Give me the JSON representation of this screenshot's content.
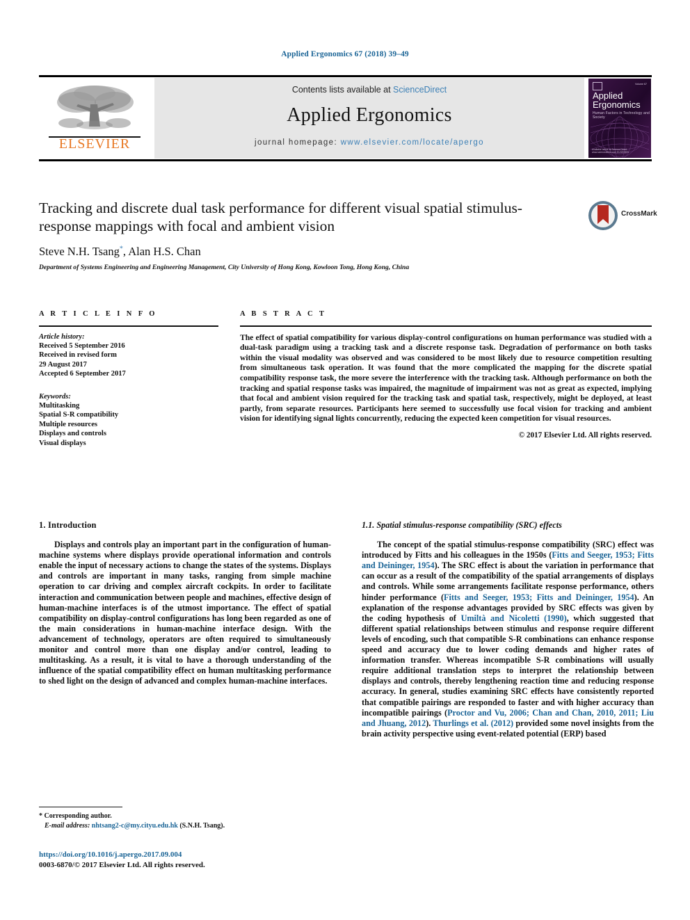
{
  "running_head": "Applied Ergonomics 67 (2018) 39–49",
  "masthead": {
    "contents_prefix": "Contents lists available at ",
    "contents_link": "ScienceDirect",
    "journal_name": "Applied Ergonomics",
    "homepage_prefix": "journal homepage: ",
    "homepage_url": "www.elsevier.com/locate/apergo",
    "publisher": "ELSEVIER",
    "cover": {
      "title": "Applied Ergonomics",
      "subtitle": "Human Factors in Technology and Society",
      "issue": "Volume 67",
      "footer": "Available online at\nScience Direct www.sciencedirect.com ELSEVIER"
    }
  },
  "article": {
    "title": "Tracking and discrete dual task performance for different visual spatial stimulus-response mappings with focal and ambient vision",
    "authors": "Steve N.H. Tsang",
    "author_marker": "*",
    "authors_rest": ", Alan H.S. Chan",
    "affiliation": "Department of Systems Engineering and Engineering Management, City University of Hong Kong, Kowloon Tong, Hong Kong, China",
    "crossmark_label": "CrossMark"
  },
  "article_info": {
    "heading": "A R T I C L E   I N F O",
    "history_label": "Article history:",
    "history": [
      "Received 5 September 2016",
      "Received in revised form",
      "29 August 2017",
      "Accepted 6 September 2017"
    ],
    "keywords_label": "Keywords:",
    "keywords": [
      "Multitasking",
      "Spatial S-R compatibility",
      "Multiple resources",
      "Displays and controls",
      "Visual displays"
    ]
  },
  "abstract": {
    "heading": "A B S T R A C T",
    "text": "The effect of spatial compatibility for various display-control configurations on human performance was studied with a dual-task paradigm using a tracking task and a discrete response task. Degradation of performance on both tasks within the visual modality was observed and was considered to be most likely due to resource competition resulting from simultaneous task operation. It was found that the more complicated the mapping for the discrete spatial compatibility response task, the more severe the interference with the tracking task. Although performance on both the tracking and spatial response tasks was impaired, the magnitude of impairment was not as great as expected, implying that focal and ambient vision required for the tracking task and spatial task, respectively, might be deployed, at least partly, from separate resources. Participants here seemed to successfully use focal vision for tracking and ambient vision for identifying signal lights concurrently, reducing the expected keen competition for visual resources.",
    "copyright": "© 2017 Elsevier Ltd. All rights reserved."
  },
  "body": {
    "left": {
      "heading": "1. Introduction",
      "paragraph": "Displays and controls play an important part in the configuration of human-machine systems where displays provide operational information and controls enable the input of necessary actions to change the states of the systems. Displays and controls are important in many tasks, ranging from simple machine operation to car driving and complex aircraft cockpits. In order to facilitate interaction and communication between people and machines, effective design of human-machine interfaces is of the utmost importance. The effect of spatial compatibility on display-control configurations has long been regarded as one of the main considerations in human-machine interface design. With the advancement of technology, operators are often required to simultaneously monitor and control more than one display and/or control, leading to multitasking. As a result, it is vital to have a thorough understanding of the influence of the spatial compatibility effect on human multitasking performance to shed light on the design of advanced and complex human-machine interfaces."
    },
    "right": {
      "heading": "1.1. Spatial stimulus-response compatibility (SRC) effects",
      "p1_a": "The concept of the spatial stimulus-response compatibility (SRC) effect was introduced by Fitts and his colleagues in the 1950s (",
      "p1_cite1": "Fitts and Seeger, 1953; Fitts and Deininger, 1954",
      "p1_b": "). The SRC effect is about the variation in performance that can occur as a result of the compatibility of the spatial arrangements of displays and controls. While some arrangements facilitate response performance, others hinder performance (",
      "p1_cite2": "Fitts and Seeger, 1953; Fitts and Deininger, 1954",
      "p1_c": "). An explanation of the response advantages provided by SRC effects was given by the coding hypothesis of ",
      "p1_cite3": "Umiltà and Nicoletti (1990)",
      "p1_d": ", which suggested that different spatial relationships between stimulus and response require different levels of encoding, such that compatible S-R combinations can enhance response speed and accuracy due to lower coding demands and higher rates of information transfer. Whereas incompatible S-R combinations will usually require additional translation steps to interpret the relationship between displays and controls, thereby lengthening reaction time and reducing response accuracy. In general, studies examining SRC effects have consistently reported that compatible pairings are responded to faster and with higher accuracy than incompatible pairings (",
      "p1_cite4": "Proctor and Vu, 2006; Chan and Chan, 2010, 2011; Liu and Jhuang, 2012",
      "p1_e": "). ",
      "p1_cite5": "Thurlings et al. (2012)",
      "p1_f": " provided some novel insights from the brain activity perspective using event-related potential (ERP) based"
    }
  },
  "footnote": {
    "corresponding": "* Corresponding author.",
    "email_label": "E-mail address:",
    "email": "nhtsang2-c@my.cityu.edu.hk",
    "email_owner": "(S.N.H. Tsang).",
    "doi": "https://doi.org/10.1016/j.apergo.2017.09.004",
    "issn_line": "0003-6870/© 2017 Elsevier Ltd. All rights reserved."
  },
  "colors": {
    "link": "#1a6496",
    "elsevier_orange": "#E87722",
    "cover_purple": "#2b0d33",
    "masthead_grey": "#e6e6e6"
  }
}
